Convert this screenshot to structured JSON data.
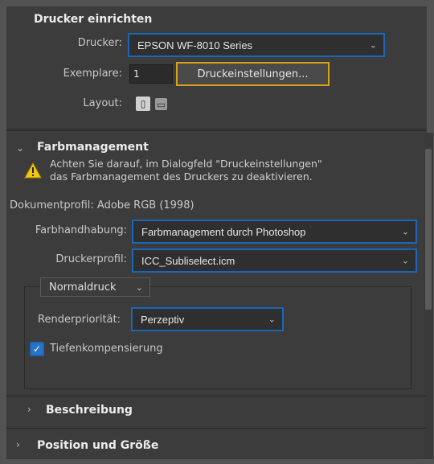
{
  "drucker_einrichten": {
    "title": "Drucker einrichten",
    "drucker_label": "Drucker:",
    "drucker_value": "EPSON WF-8010 Series",
    "exemplare_label": "Exemplare:",
    "exemplare_value": "1",
    "druckeinstellungen_button": "Druckeinstellungen...",
    "layout_label": "Layout:"
  },
  "farbmanagement": {
    "title": "Farbmanagement",
    "warning_line1": "Achten Sie darauf, im Dialogfeld \"Druckeinstellungen\"",
    "warning_line2": "das Farbmanagement des Druckers zu deaktivieren.",
    "dokumentprofil": "Dokumentprofil: Adobe RGB (1998)",
    "farbhandhabung_label": "Farbhandhabung:",
    "farbhandhabung_value": "Farbmanagement durch Photoshop",
    "druckerprofil_label": "Druckerprofil:",
    "druckerprofil_value": "ICC_Subliselect.icm",
    "mode_value": "Normaldruck",
    "renderprioritaet_label": "Renderpriorität:",
    "renderprioritaet_value": "Perzeptiv",
    "tiefenkompensierung_label": "Tiefenkompensierung",
    "tiefenkompensierung_checked": true
  },
  "sections": {
    "beschreibung": "Beschreibung",
    "position_groesse": "Position und Größe"
  },
  "colors": {
    "panel_bg": "#3c3c3c",
    "focus_blue": "#1a66b8",
    "focus_yellow": "#d8a21a",
    "warning_yellow": "#f2c811"
  }
}
